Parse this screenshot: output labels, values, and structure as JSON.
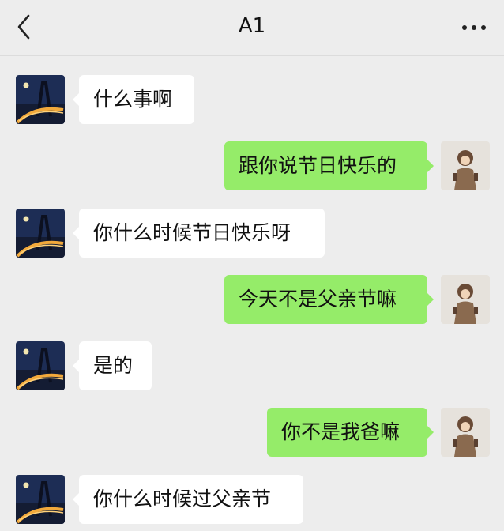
{
  "header": {
    "title": "A1",
    "back_icon": "chevron-left-icon",
    "more_icon": "ellipsis-icon"
  },
  "colors": {
    "background": "#ededed",
    "incoming_bubble": "#ffffff",
    "outgoing_bubble": "#95ec69"
  },
  "messages": [
    {
      "direction": "incoming",
      "text": "什么事啊"
    },
    {
      "direction": "outgoing",
      "text": "跟你说节日快乐的"
    },
    {
      "direction": "incoming",
      "text": "你什么时候节日快乐呀"
    },
    {
      "direction": "outgoing",
      "text": "今天不是父亲节嘛"
    },
    {
      "direction": "incoming",
      "text": "是的"
    },
    {
      "direction": "outgoing",
      "text": "你不是我爸嘛"
    },
    {
      "direction": "incoming",
      "text": "你什么时候过父亲节"
    }
  ]
}
